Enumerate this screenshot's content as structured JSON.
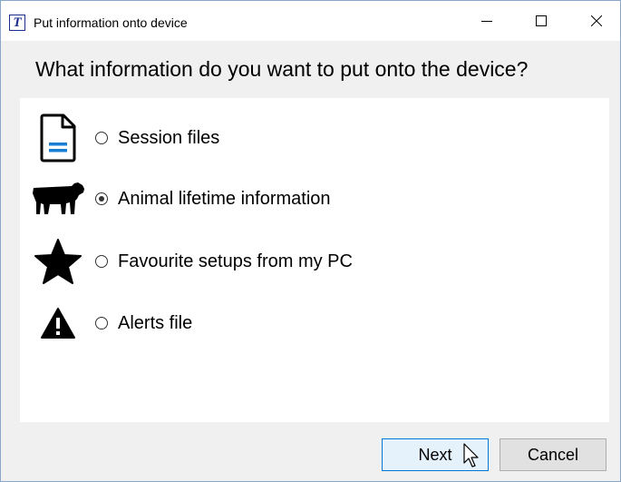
{
  "window": {
    "title": "Put information onto device",
    "app_icon_letter": "T",
    "controls": [
      "minimize-icon",
      "maximize-icon",
      "close-icon"
    ]
  },
  "heading": "What information do you want to put onto the device?",
  "options": [
    {
      "label": "Session files",
      "icon": "document-icon",
      "selected": false
    },
    {
      "label": "Animal lifetime information",
      "icon": "cow-icon",
      "selected": true
    },
    {
      "label": "Favourite setups from my PC",
      "icon": "star-icon",
      "selected": false
    },
    {
      "label": "Alerts file",
      "icon": "warning-icon",
      "selected": false
    }
  ],
  "buttons": {
    "next_label": "Next",
    "cancel_label": "Cancel"
  },
  "colors": {
    "accent": "#0078d7",
    "document_lines": "#1a7fd4",
    "icon_fill": "#000000"
  }
}
